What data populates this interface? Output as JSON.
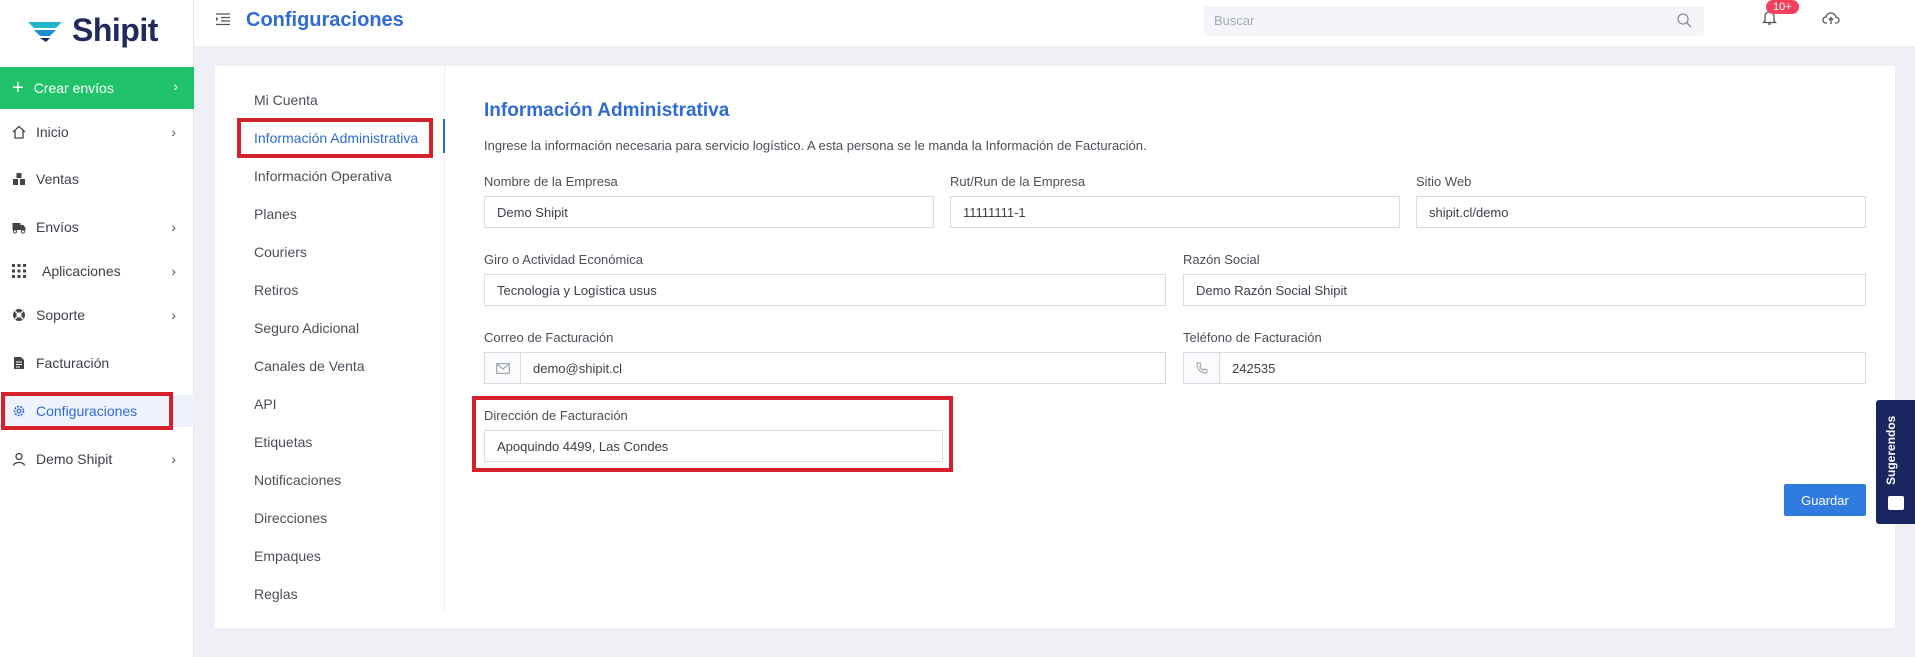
{
  "brand": {
    "name": "Shipit"
  },
  "sidebar": {
    "create": {
      "label": "Crear envíos"
    },
    "items": [
      {
        "label": "Inicio",
        "icon": "home-icon",
        "chevron": true
      },
      {
        "label": "Ventas",
        "icon": "sales-icon",
        "chevron": false
      },
      {
        "label": "Envíos",
        "icon": "truck-icon",
        "chevron": true
      },
      {
        "label": "Aplicaciones",
        "icon": "grid-icon",
        "chevron": true
      },
      {
        "label": "Soporte",
        "icon": "lifebuoy-icon",
        "chevron": true
      },
      {
        "label": "Facturación",
        "icon": "document-icon",
        "chevron": false
      },
      {
        "label": "Configuraciones",
        "icon": "gear-icon",
        "chevron": false,
        "active": true
      },
      {
        "label": "Demo Shipit",
        "icon": "user-icon",
        "chevron": true
      }
    ]
  },
  "topbar": {
    "title": "Configuraciones",
    "search_placeholder": "Buscar",
    "notification_badge": "10+"
  },
  "subnav": {
    "items": [
      "Mi Cuenta",
      "Información Administrativa",
      "Información Operativa",
      "Planes",
      "Couriers",
      "Retiros",
      "Seguro Adicional",
      "Canales de Venta",
      "API",
      "Etiquetas",
      "Notificaciones",
      "Direcciones",
      "Empaques",
      "Reglas"
    ],
    "active_index": 1
  },
  "form": {
    "title": "Información Administrativa",
    "description": "Ingrese la información necesaria para servicio logístico. A esta persona se le manda la Información de Facturación.",
    "company_name": {
      "label": "Nombre de la Empresa",
      "value": "Demo Shipit"
    },
    "rut": {
      "label": "Rut/Run de la Empresa",
      "value": "11111111-1"
    },
    "website": {
      "label": "Sitio Web",
      "value": "shipit.cl/demo"
    },
    "business": {
      "label": "Giro o Actividad Económica",
      "value": "Tecnología y Logística usus"
    },
    "legal_name": {
      "label": "Razón Social",
      "value": "Demo Razón Social Shipit"
    },
    "billing_email": {
      "label": "Correo de Facturación",
      "value": "demo@shipit.cl"
    },
    "billing_phone": {
      "label": "Teléfono de Facturación",
      "value": "242535"
    },
    "billing_address": {
      "label": "Dirección de Facturación",
      "value": "Apoquindo 4499, Las Condes"
    },
    "save_label": "Guardar"
  },
  "feedback_tab": {
    "label": "Sugerendos"
  },
  "colors": {
    "accent": "#2f6bd3",
    "create_button": "#20c26a",
    "highlight": "#d4212b",
    "save_button": "#2f7be0",
    "badge": "#f0415e",
    "feedback_tab": "#1a2660"
  }
}
